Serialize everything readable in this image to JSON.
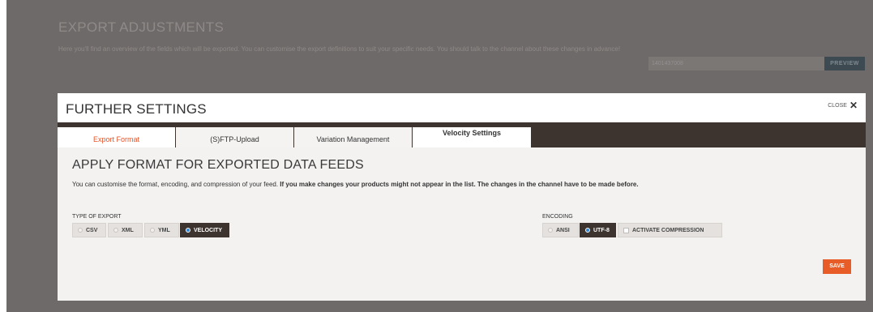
{
  "background": {
    "title": "EXPORT ADJUSTMENTS",
    "description": "Here you'll find an overview of the fields which will be exported. You can customise the export definitions to suit your specific needs. You should talk to the channel about these changes in advance!",
    "id_value": "1401437008",
    "preview_label": "PREVIEW"
  },
  "modal": {
    "title": "FURTHER SETTINGS",
    "close_label": "CLOSE",
    "tabs": [
      {
        "label": "Export Format"
      },
      {
        "label": "(S)FTP-Upload"
      },
      {
        "label": "Variation Management"
      },
      {
        "label": "Velocity Settings"
      }
    ],
    "section_title": "APPLY FORMAT FOR EXPORTED DATA FEEDS",
    "desc_normal": "You can customise the format, encoding, and compression of your feed. ",
    "desc_bold": "If you make changes your products might not appear in the list. The changes in the channel have to be made before.",
    "type_label": "TYPE OF EXPORT",
    "types": [
      "CSV",
      "XML",
      "YML",
      "VELOCITY"
    ],
    "selected_type": "VELOCITY",
    "encoding_label": "ENCODING",
    "encodings": [
      "ANSI",
      "UTF-8"
    ],
    "selected_encoding": "UTF-8",
    "compression_label": "ACTIVATE COMPRESSION",
    "save_label": "SAVE"
  },
  "colors": {
    "accent": "#e85d27",
    "dark": "#3d342f",
    "radio_selected": "#2e86d6"
  }
}
